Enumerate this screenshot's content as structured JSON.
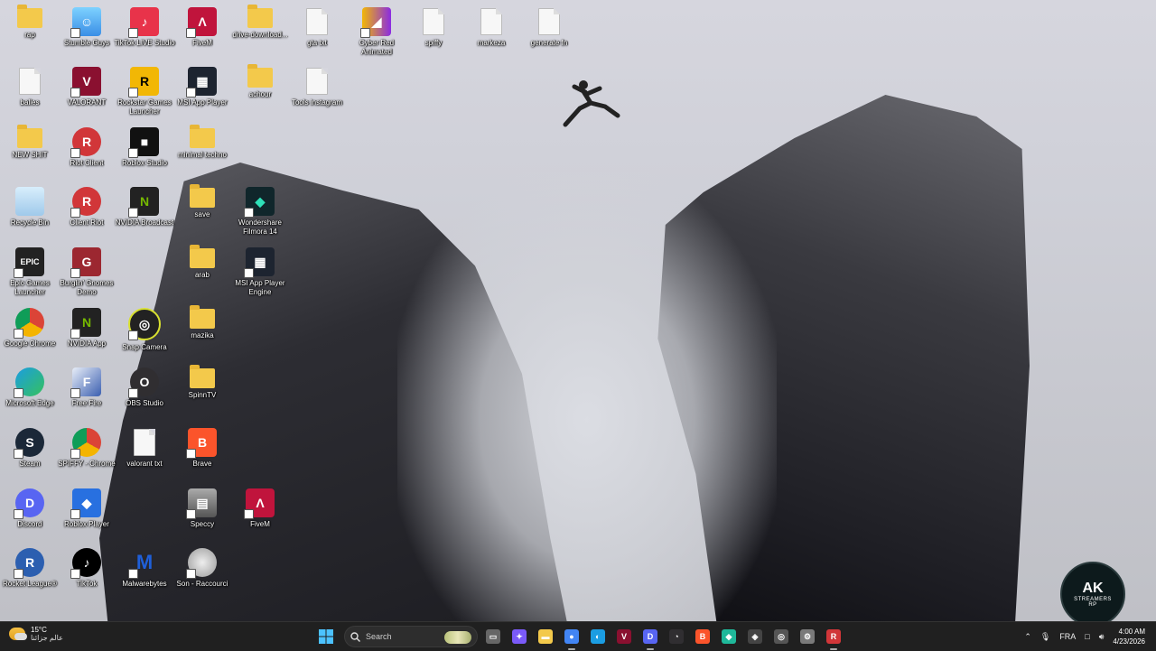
{
  "desktop": {
    "icons": [
      {
        "label": "rap",
        "type": "folder"
      },
      {
        "label": "balles",
        "type": "file"
      },
      {
        "label": "NEW SHIT",
        "type": "folder"
      },
      {
        "label": "Recycle Bin",
        "type": "recycle-bin"
      },
      {
        "label": "Epic Games Launcher",
        "type": "epic"
      },
      {
        "label": "Google Chrome",
        "type": "chrome"
      },
      {
        "label": "Microsoft Edge",
        "type": "edge"
      },
      {
        "label": "Steam",
        "type": "steam"
      },
      {
        "label": "Discord",
        "type": "discord"
      },
      {
        "label": "Rocket League®",
        "type": "rocket-league"
      },
      {
        "label": "Stumble Guys",
        "type": "stumble"
      },
      {
        "label": "VALORANT",
        "type": "valorant"
      },
      {
        "label": "Riot Client",
        "type": "riot"
      },
      {
        "label": "Client Riot",
        "type": "riot"
      },
      {
        "label": "Burglin' Gnomes Demo",
        "type": "gnomes"
      },
      {
        "label": "NVIDIA App",
        "type": "nvidia"
      },
      {
        "label": "Free Fire",
        "type": "freefire"
      },
      {
        "label": "SPIFFY - Chrome",
        "type": "chrome"
      },
      {
        "label": "Roblox Player",
        "type": "roblox-player"
      },
      {
        "label": "TikTok",
        "type": "tiktok"
      },
      {
        "label": "TikTok LIVE Studio",
        "type": "tiktok-live"
      },
      {
        "label": "Rockstar Games Launcher",
        "type": "rockstar"
      },
      {
        "label": "Roblox Studio",
        "type": "roblox-studio"
      },
      {
        "label": "NVIDIA Broadcast",
        "type": "nvidia-broadcast"
      },
      {
        "label": "Snap Camera",
        "type": "snap"
      },
      {
        "label": "OBS Studio",
        "type": "obs"
      },
      {
        "label": "Malwarebytes",
        "type": "malwarebytes"
      },
      {
        "label": "FiveM",
        "type": "fivem"
      },
      {
        "label": "MSI App Player",
        "type": "msi"
      },
      {
        "label": "minimal techno",
        "type": "folder"
      },
      {
        "label": "save",
        "type": "folder"
      },
      {
        "label": "arab",
        "type": "folder"
      },
      {
        "label": "mazika",
        "type": "folder"
      },
      {
        "label": "SpinnTV",
        "type": "folder"
      },
      {
        "label": "valorant txt",
        "type": "file"
      },
      {
        "label": "Brave",
        "type": "brave"
      },
      {
        "label": "Speccy",
        "type": "speccy"
      },
      {
        "label": "Son - Raccourci",
        "type": "speaker"
      },
      {
        "label": "drive-download...",
        "type": "folder"
      },
      {
        "label": "achour",
        "type": "folder"
      },
      {
        "label": "Wondershare Filmora 14",
        "type": "filmora"
      },
      {
        "label": "MSI App Player Engine",
        "type": "msi"
      },
      {
        "label": "FiveM",
        "type": "fivem"
      },
      {
        "label": "gta txt",
        "type": "file"
      },
      {
        "label": "Tools instagram",
        "type": "file"
      },
      {
        "label": "Cyber Red Animated",
        "type": "cyber"
      },
      {
        "label": "spiffy",
        "type": "file"
      },
      {
        "label": "markeza",
        "type": "file"
      },
      {
        "label": "generate fn",
        "type": "file"
      }
    ],
    "logo": {
      "big": "AK",
      "small": "STREAMERS",
      "tag": "RP"
    }
  },
  "taskbar": {
    "weather": {
      "temp": "15°C",
      "desc": "عالم جزائنا"
    },
    "search": {
      "label": "Search"
    },
    "apps": [
      {
        "name": "task-view",
        "color": "#666666"
      },
      {
        "name": "copilot",
        "color": "#7a5af8"
      },
      {
        "name": "file-explorer",
        "color": "#f3c94b"
      },
      {
        "name": "chrome",
        "color": "#4285f4"
      },
      {
        "name": "edge",
        "color": "#1b9de2"
      },
      {
        "name": "valorant",
        "color": "#8a1030"
      },
      {
        "name": "discord",
        "color": "#5865f2"
      },
      {
        "name": "obs",
        "color": "#302e31"
      },
      {
        "name": "brave",
        "color": "#fb542b"
      },
      {
        "name": "filmora",
        "color": "#1fb89a"
      },
      {
        "name": "unity",
        "color": "#444444"
      },
      {
        "name": "snap",
        "color": "#555555"
      },
      {
        "name": "settings",
        "color": "#7a7a7a"
      },
      {
        "name": "riot",
        "color": "#d13639"
      }
    ],
    "tray": {
      "lang": "FRA",
      "time": "4:00 AM",
      "date": "4/23/2026"
    }
  }
}
